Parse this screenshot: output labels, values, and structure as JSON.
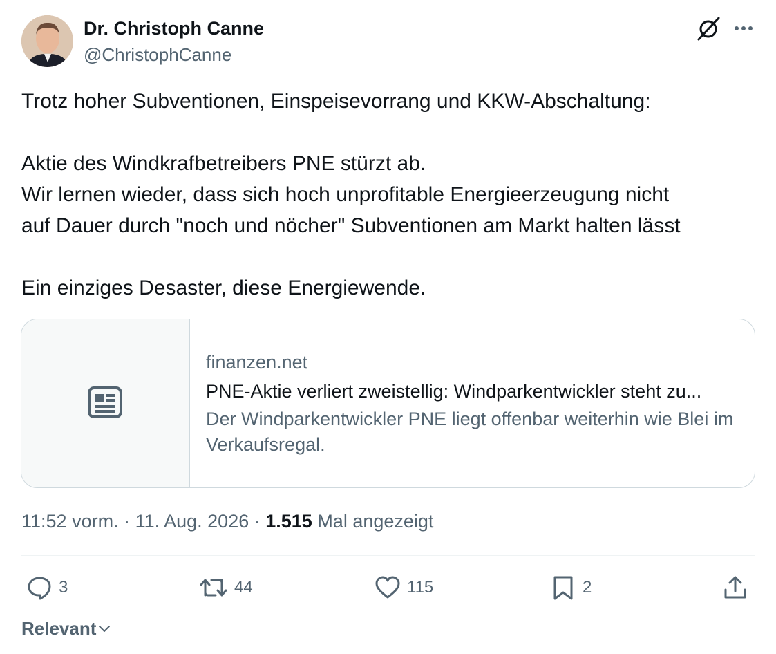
{
  "author": {
    "display_name": "Dr. Christoph Canne",
    "handle": "@ChristophCanne"
  },
  "header_icons": [
    "grok-icon",
    "more-icon"
  ],
  "tweet": {
    "lines": [
      "Trotz hoher Subventionen, Einspeisevorrang und KKW-Abschaltung:",
      "Aktie des Windkrafbetreibers PNE stürzt ab.",
      "Wir lernen wieder, dass sich hoch unprofitable Energieerzeugung nicht",
      "auf Dauer durch \"noch und nöcher\" Subventionen am Markt halten lässt",
      "Ein einziges Desaster, diese Energiewende."
    ]
  },
  "card": {
    "domain": "finanzen.net",
    "title": "PNE-Aktie verliert zweistellig: Windparkentwickler steht zu...",
    "description": "Der Windparkentwickler PNE liegt offenbar weiterhin wie Blei im Verkaufsregal.",
    "icon": "news-article-icon"
  },
  "meta": {
    "time": "11:52 vorm.",
    "sep1": " · ",
    "date": "11. Aug. 2026",
    "sep2": " · ",
    "views": "1.515",
    "views_label": " Mal angezeigt"
  },
  "actions": {
    "replies": "3",
    "reposts": "44",
    "likes": "115",
    "bookmarks": "2"
  },
  "sort": {
    "label": "Relevant"
  },
  "colors": {
    "text": "#0f1419",
    "secondary": "#536471",
    "border": "#cfd9de"
  }
}
